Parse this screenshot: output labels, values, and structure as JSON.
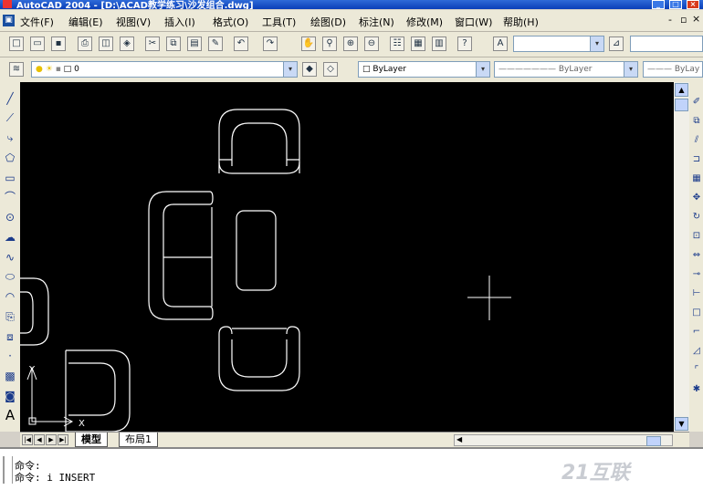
{
  "window": {
    "title": "AutoCAD 2004 - [D:\\ACAD教学练习\\沙发组合.dwg]"
  },
  "menu": [
    "文件(F)",
    "编辑(E)",
    "视图(V)",
    "插入(I)",
    "格式(O)",
    "工具(T)",
    "绘图(D)",
    "标注(N)",
    "修改(M)",
    "窗口(W)",
    "帮助(H)"
  ],
  "layer": {
    "current": "0"
  },
  "properties": {
    "color": "ByLayer",
    "linetype": "ByLayer",
    "lineweight": "ByLay"
  },
  "canvas": {
    "ucs_x": "X",
    "ucs_y": "Y"
  },
  "tabs": [
    "模型",
    "布局1"
  ],
  "command": {
    "line1": "命令:",
    "line2": "命令: i INSERT"
  },
  "watermark": "21互联",
  "colors": {
    "title_bar": "#0a3fb8",
    "canvas": "#000000",
    "drawing": "#ffffff"
  }
}
